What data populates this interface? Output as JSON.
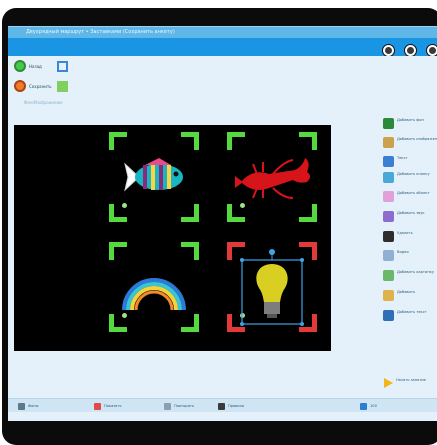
{
  "window": {
    "title": "Двухрядный маршрут • Заставками (Сохранить анкету)"
  },
  "toolbar_left": {
    "button_1": "Назад",
    "button_2": "Сохранить",
    "hint": "Фон/Изображение"
  },
  "right_panel": {
    "items": [
      {
        "label": "Добавить фон",
        "color": "#2a8a3a"
      },
      {
        "label": "Добавить изображение",
        "color": "#c9a24b"
      },
      {
        "label": "Текст",
        "color": "#3a7fd0"
      },
      {
        "label": "Добавить кнопку",
        "color": "#4aa8d8"
      },
      {
        "label": "Добавить объект",
        "color": "#e2a0d8"
      },
      {
        "label": "Добавить звук",
        "color": "#8e6ccf"
      },
      {
        "label": "Удалить",
        "color": "#2d2d2d"
      },
      {
        "label": "Видео",
        "color": "#8fb0d0"
      },
      {
        "label": "Добавить картинку",
        "color": "#6bb86b"
      },
      {
        "label": "Добавить",
        "color": "#e0b24a"
      },
      {
        "label": "Добавить текст",
        "color": "#2f6fb8"
      }
    ],
    "bottom_action": "Начать занятие"
  },
  "statusbar": {
    "items": [
      "Фоны",
      "Показать",
      "Повторить",
      "Правила",
      "100"
    ]
  },
  "stage": {
    "cells": [
      {
        "name": "fish",
        "selected": false
      },
      {
        "name": "lobster",
        "selected": false
      },
      {
        "name": "rainbow",
        "selected": false
      },
      {
        "name": "light-bulb",
        "selected": true
      }
    ]
  }
}
